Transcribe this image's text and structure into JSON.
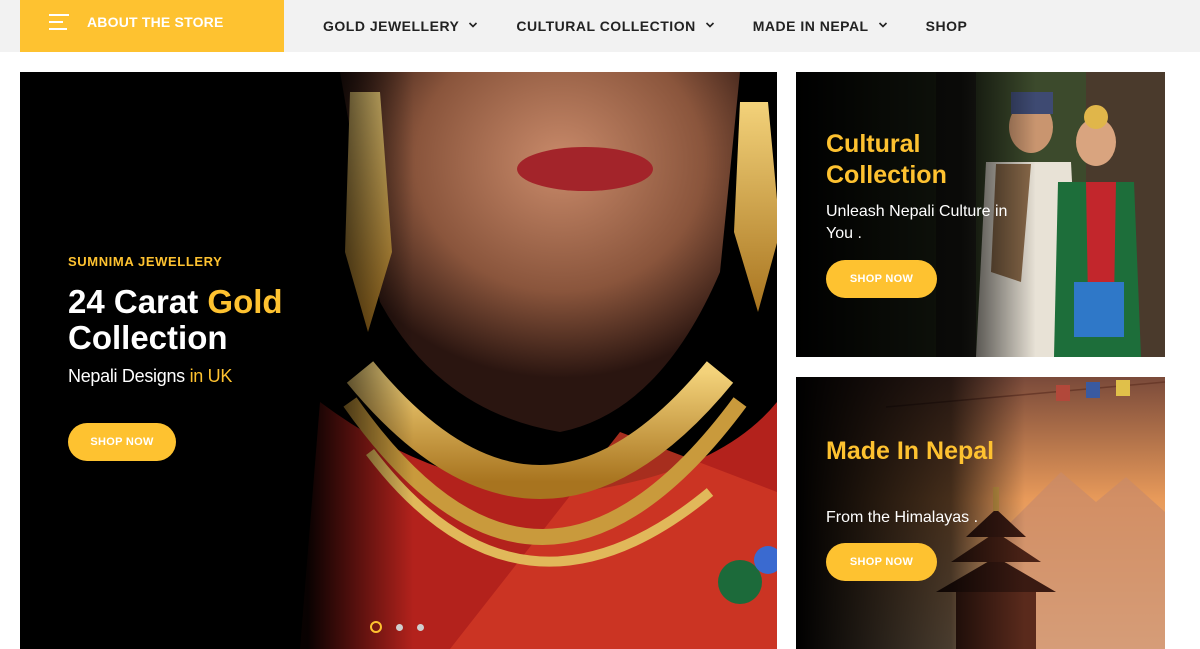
{
  "header": {
    "store_label": "ABOUT THE STORE",
    "nav": [
      {
        "label": "GOLD JEWELLERY",
        "dropdown": true
      },
      {
        "label": "CULTURAL COLLECTION",
        "dropdown": true
      },
      {
        "label": "MADE IN NEPAL",
        "dropdown": true
      },
      {
        "label": "SHOP",
        "dropdown": false
      }
    ]
  },
  "hero": {
    "eyebrow": "SUMNIMA JEWELLERY",
    "title_part1": "24 Carat ",
    "title_highlight": "Gold",
    "title_line2": "Collection",
    "subtitle_part1": "Nepali Designs ",
    "subtitle_highlight": "in UK",
    "button": "SHOP NOW",
    "slides": 3,
    "active_slide": 1
  },
  "cards": [
    {
      "title": "Cultural Collection",
      "subtitle": "Unleash Nepali Culture in You .",
      "button": "SHOP NOW"
    },
    {
      "title": "Made In Nepal",
      "subtitle": "From the Himalayas .",
      "button": "SHOP NOW"
    }
  ],
  "colors": {
    "accent": "#fec230",
    "nav_bg": "#f2f2f2",
    "text_dark": "#222222"
  },
  "icons": {
    "menu": "hamburger-menu-icon",
    "dropdown": "chevron-down-icon"
  }
}
